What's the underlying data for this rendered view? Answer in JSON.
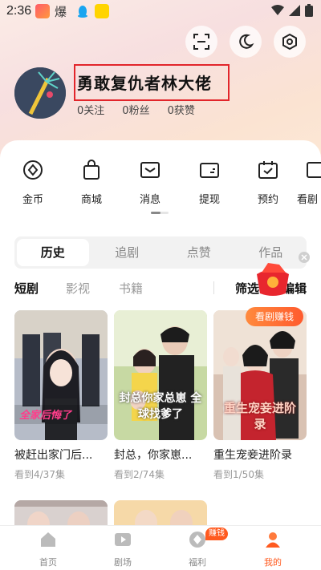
{
  "status_bar": {
    "time": "2:36"
  },
  "profile": {
    "username": "勇敢复仇者林大佬",
    "stats": [
      {
        "value": "0",
        "label": "关注"
      },
      {
        "value": "0",
        "label": "粉丝"
      },
      {
        "value": "0",
        "label": "获赞"
      }
    ]
  },
  "functions": [
    {
      "label": "金币",
      "icon": "coin-icon"
    },
    {
      "label": "商城",
      "icon": "shopping-bag-icon"
    },
    {
      "label": "消息",
      "icon": "message-icon"
    },
    {
      "label": "提现",
      "icon": "wallet-icon"
    },
    {
      "label": "预约",
      "icon": "calendar-icon"
    },
    {
      "label": "看剧",
      "icon": "watch-icon"
    }
  ],
  "tabs": [
    "历史",
    "追剧",
    "点赞",
    "作品"
  ],
  "categories": [
    "短剧",
    "影视",
    "书籍"
  ],
  "filter_label": "筛选",
  "edit_label": "编辑",
  "earn_badge": "看剧赚钱",
  "cards": [
    {
      "title": "被赶出家门后...",
      "progress": "看到4/37集",
      "poster_text": "全家后悔了"
    },
    {
      "title": "封总，你家崽...",
      "progress": "看到2/74集",
      "poster_text": "封总你家总崽 全球找爹了"
    },
    {
      "title": "重生宠妾进阶录",
      "progress": "看到1/50集",
      "poster_text": "重生宠妾进阶录"
    }
  ],
  "bottom_nav": [
    {
      "label": "首页",
      "icon": "home-icon"
    },
    {
      "label": "剧场",
      "icon": "theater-icon"
    },
    {
      "label": "福利",
      "icon": "welfare-icon"
    },
    {
      "label": "我的",
      "icon": "profile-icon"
    }
  ],
  "nav_badge": "赚钱",
  "colors": {
    "accent": "#ff5a1f",
    "highlight_border": "#e2252b"
  }
}
